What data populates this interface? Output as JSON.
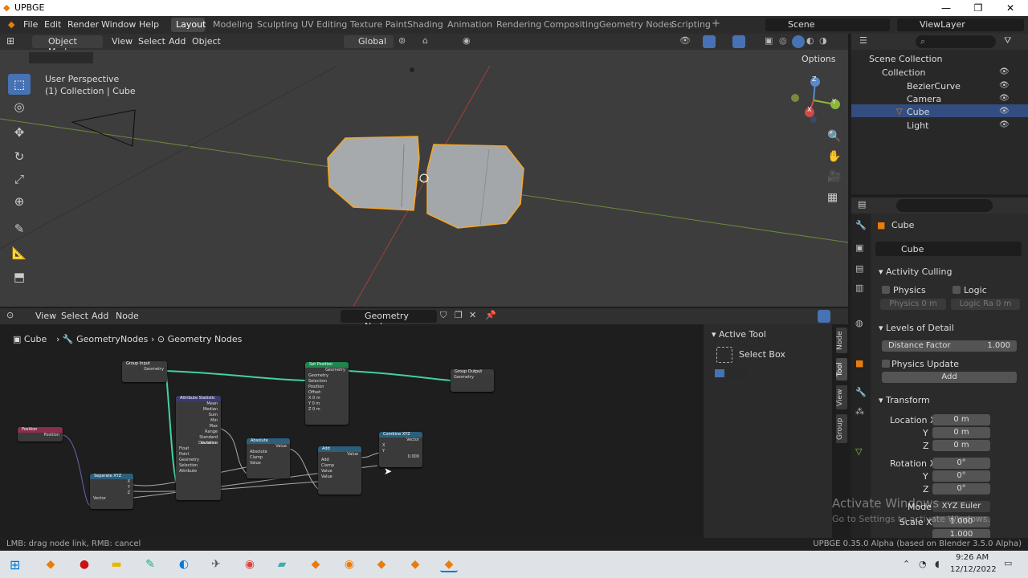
{
  "window": {
    "title": "UPBGE",
    "min": "—",
    "max": "❐",
    "close": "✕"
  },
  "menu": [
    "File",
    "Edit",
    "Render",
    "Window",
    "Help"
  ],
  "workspaces": [
    "Layout",
    "Modeling",
    "Sculpting",
    "UV Editing",
    "Texture Paint",
    "Shading",
    "Animation",
    "Rendering",
    "Compositing",
    "Geometry Nodes",
    "Scripting"
  ],
  "workspace_add": "+",
  "scene": "Scene",
  "view_layer": "ViewLayer",
  "viewport": {
    "mode": "Object Mode",
    "menus": [
      "View",
      "Select",
      "Add",
      "Object"
    ],
    "orientation": "Global",
    "options": "Options",
    "perspective_label": "User Perspective",
    "collection_label": "(1) Collection | Cube",
    "gizmo": {
      "z": "Z",
      "y": "Y",
      "x": "X"
    }
  },
  "outliner": {
    "root": "Scene Collection",
    "collection": "Collection",
    "items": [
      "BezierCurve",
      "Camera",
      "Cube",
      "Light"
    ]
  },
  "properties": {
    "object_name": "Cube",
    "data_name": "Cube",
    "activity_culling": "Activity Culling",
    "physics": "Physics",
    "logic": "Logic",
    "physics_dist": "Physics",
    "physics_dist_val": "0 m",
    "logic_ra": "Logic Ra",
    "logic_ra_val": "0 m",
    "levels_of_detail": "Levels of Detail",
    "distance_factor": "Distance Factor",
    "distance_factor_val": "1.000",
    "physics_update": "Physics Update",
    "add": "Add",
    "transform": "Transform",
    "location_x": "Location X",
    "y": "Y",
    "z": "Z",
    "loc_x": "0 m",
    "loc_y": "0 m",
    "loc_z": "0 m",
    "rotation_x": "Rotation X",
    "rot_x": "0°",
    "rot_y": "0°",
    "rot_z": "0°",
    "mode": "Mode",
    "mode_val": "XYZ Euler",
    "scale_x": "Scale X",
    "scale_x_val": "1.000",
    "scale_y_val": "1.000"
  },
  "node_editor": {
    "menus": [
      "View",
      "Select",
      "Add",
      "Node"
    ],
    "tree_name": "Geometry Nodes",
    "breadcrumb": [
      "Cube",
      "GeometryNodes",
      "Geometry Nodes"
    ],
    "tabs": [
      "Node",
      "Tool",
      "View",
      "Group"
    ],
    "active_tool": "Active Tool",
    "select_box": "Select Box",
    "nodes": {
      "group_input": {
        "title": "Group Input",
        "out": "Geometry"
      },
      "set_position": {
        "title": "Set Position",
        "rows": [
          "Geometry",
          "Geometry",
          "Selection",
          "Position",
          "Offset:",
          "X  0 m",
          "Y  0 m",
          "Z  0 m"
        ]
      },
      "group_output": {
        "title": "Group Output",
        "rows": [
          "Geometry"
        ]
      },
      "attr_stat": {
        "title": "Attribute Statistic",
        "rows": [
          "Mean",
          "Median",
          "Sum",
          "Min",
          "Max",
          "Range",
          "Standard Deviation",
          "Variance",
          "Float",
          "Point",
          "Geometry",
          "Selection",
          "Attribute"
        ]
      },
      "position": {
        "title": "Position",
        "rows": [
          "Position"
        ]
      },
      "separate": {
        "title": "Separate XYZ",
        "rows": [
          "X",
          "Y",
          "Z",
          "Vector"
        ]
      },
      "absolute": {
        "title": "Absolute",
        "rows": [
          "Value",
          "Absolute",
          "Clamp",
          "Value"
        ]
      },
      "add": {
        "title": "Add",
        "rows": [
          "Value",
          "Add",
          "Clamp",
          "Value",
          "Value"
        ]
      },
      "combine": {
        "title": "Combine XYZ",
        "rows": [
          "Vector",
          "X",
          "Y",
          "0.000"
        ]
      }
    }
  },
  "watermark": {
    "line1": "Activate Windows",
    "line2": "Go to Settings to activate Windows."
  },
  "status": {
    "left": "LMB: drag node link, RMB: cancel",
    "right": "UPBGE 0.35.0 Alpha (based on Blender 3.5.0 Alpha)"
  },
  "taskbar": {
    "time": "9:26 AM",
    "date": "12/12/2022"
  },
  "colors": {
    "accent": "#4772b3",
    "selected_outline": "#f5a623",
    "link_green": "#41d39b"
  }
}
